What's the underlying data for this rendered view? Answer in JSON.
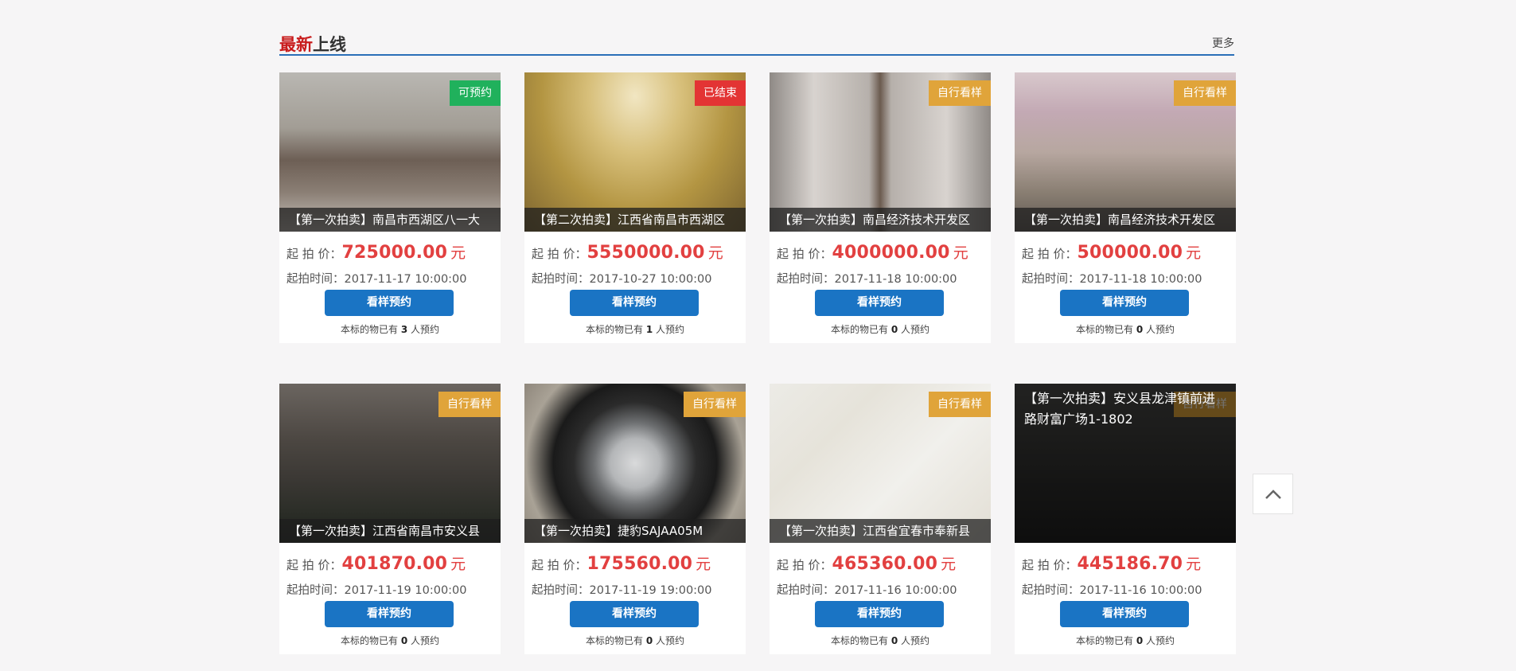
{
  "section": {
    "title_accent": "最新",
    "title_rest": "上线",
    "more": "更多"
  },
  "labels": {
    "price_prefix": "起 拍 价：",
    "time_prefix": "起拍时间：",
    "button": "看样预约",
    "count_prefix": "本标的物已有",
    "count_suffix": "人预约",
    "unit": "元"
  },
  "items": [
    {
      "badge": "可预约",
      "badge_color": "#20b15c",
      "caption": "【第一次拍卖】南昌市西湖区八一大",
      "price": "725000.00",
      "time": "2017-11-17 10:00:00",
      "count": "3",
      "image": "living-room-photo"
    },
    {
      "badge": "已结束",
      "badge_color": "#e33434",
      "caption": "【第二次拍卖】江西省南昌市西湖区",
      "price": "5550000.00",
      "time": "2017-10-27 10:00:00",
      "count": "1",
      "image": "dining-room-photo"
    },
    {
      "badge": "自行看样",
      "badge_color": "#e0a43a",
      "caption": "【第一次拍卖】南昌经济技术开发区",
      "price": "4000000.00",
      "time": "2017-11-18 10:00:00",
      "count": "0",
      "image": "hotel-corridor-photo"
    },
    {
      "badge": "自行看样",
      "badge_color": "#e0a43a",
      "caption": "【第一次拍卖】南昌经济技术开发区",
      "price": "500000.00",
      "time": "2017-11-18 10:00:00",
      "count": "0",
      "image": "street-building-photo"
    },
    {
      "badge": "自行看样",
      "badge_color": "#e0a43a",
      "caption": "【第一次拍卖】江西省南昌市安义县",
      "price": "401870.00",
      "time": "2017-11-19 10:00:00",
      "count": "0",
      "image": "apartment-tower-photo"
    },
    {
      "badge": "自行看样",
      "badge_color": "#e0a43a",
      "caption": "【第一次拍卖】捷豹SAJAA05M",
      "price": "175560.00",
      "time": "2017-11-19 19:00:00",
      "count": "0",
      "image": "car-wheel-photo"
    },
    {
      "badge": "自行看样",
      "badge_color": "#e0a43a",
      "caption": "【第一次拍卖】江西省宜春市奉新县",
      "price": "465360.00",
      "time": "2017-11-16 10:00:00",
      "count": "0",
      "image": "map-photo"
    },
    {
      "badge": "自行看样",
      "badge_color": "#e0a43a",
      "caption": "",
      "overlay": "【第一次拍卖】安义县龙津镇前进路财富广场1-1802",
      "price": "445186.70",
      "time": "2017-11-16 10:00:00",
      "count": "0",
      "image": "dark-room-photo"
    }
  ],
  "back_to_top": {
    "icon": "chevron-up-icon"
  }
}
